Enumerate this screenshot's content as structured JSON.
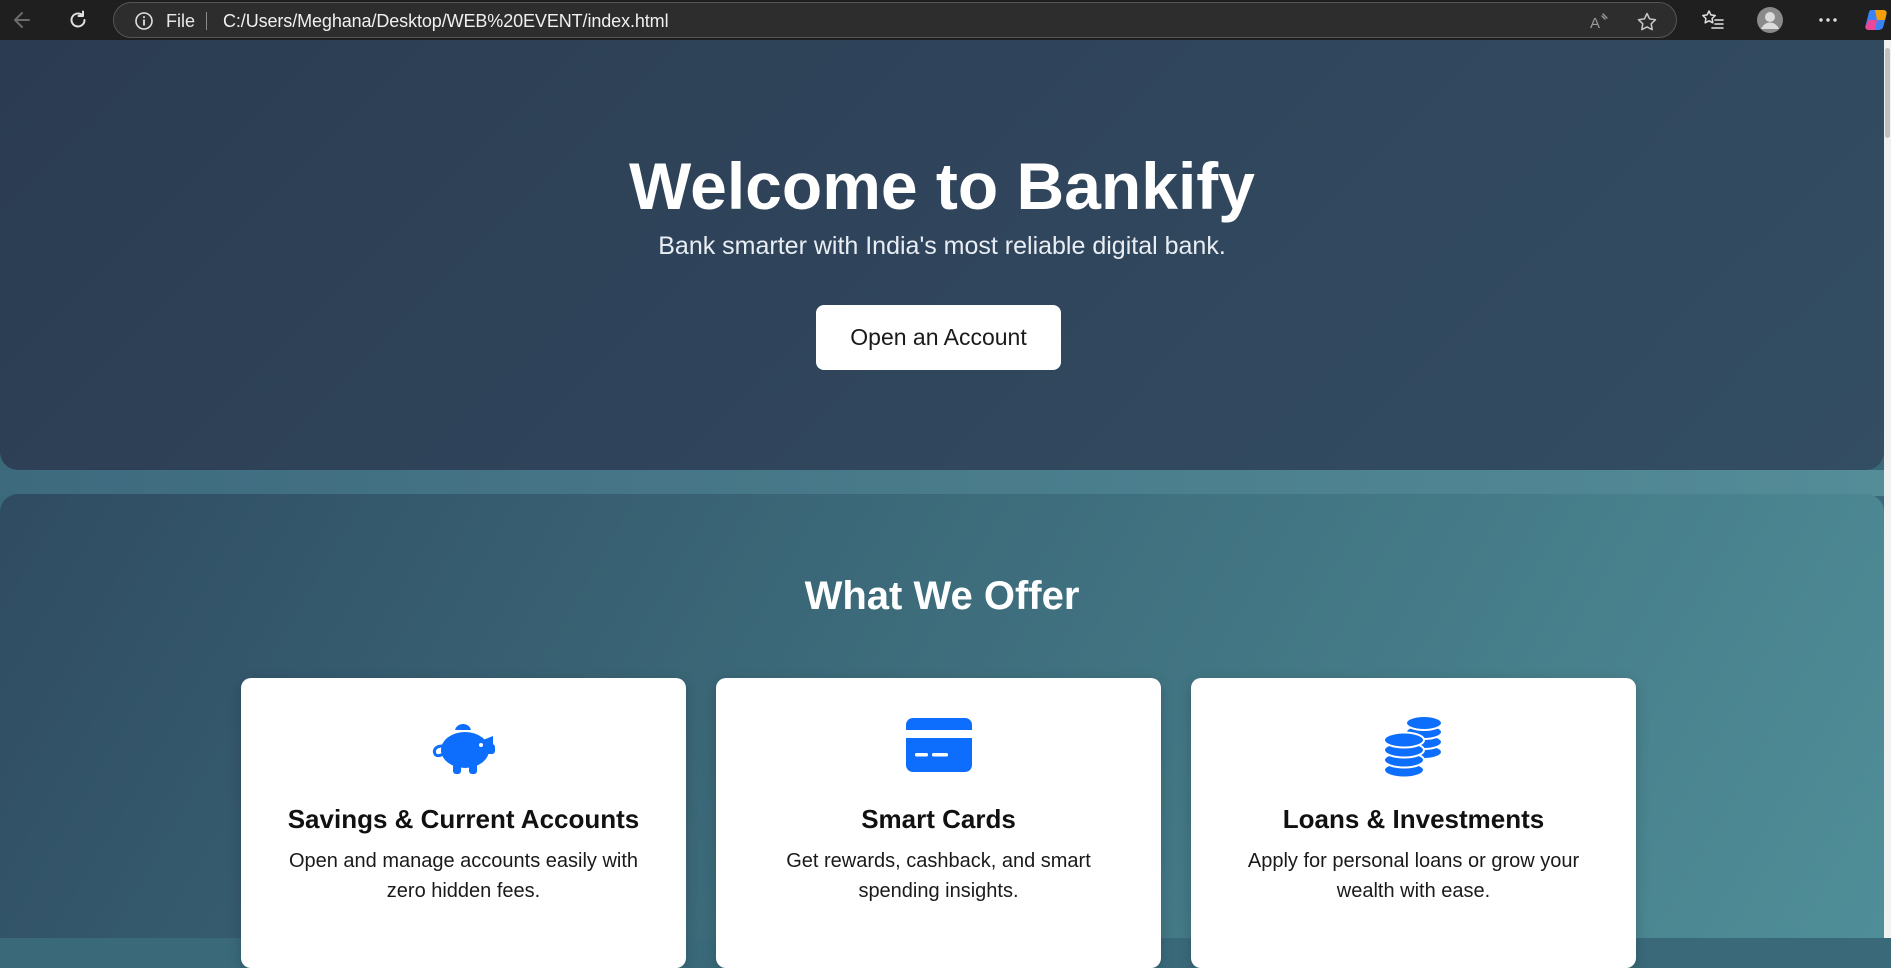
{
  "browser": {
    "file_label": "File",
    "url": "C:/Users/Meghana/Desktop/WEB%20EVENT/index.html"
  },
  "hero": {
    "title": "Welcome to Bankify",
    "subtitle": "Bank smarter with India's most reliable digital bank.",
    "cta_label": "Open an Account"
  },
  "offers": {
    "title": "What We Offer",
    "cards": [
      {
        "icon": "piggy-bank-icon",
        "title": "Savings & Current Accounts",
        "description": "Open and manage accounts easily with zero hidden fees."
      },
      {
        "icon": "credit-card-icon",
        "title": "Smart Cards",
        "description": "Get rewards, cashback, and smart spending insights."
      },
      {
        "icon": "coins-icon",
        "title": "Loans & Investments",
        "description": "Apply for personal loans or grow your wealth with ease."
      }
    ]
  },
  "colors": {
    "accent": "#0d6efd",
    "hero_bg": "#2f4358",
    "card_bg": "#ffffff"
  }
}
